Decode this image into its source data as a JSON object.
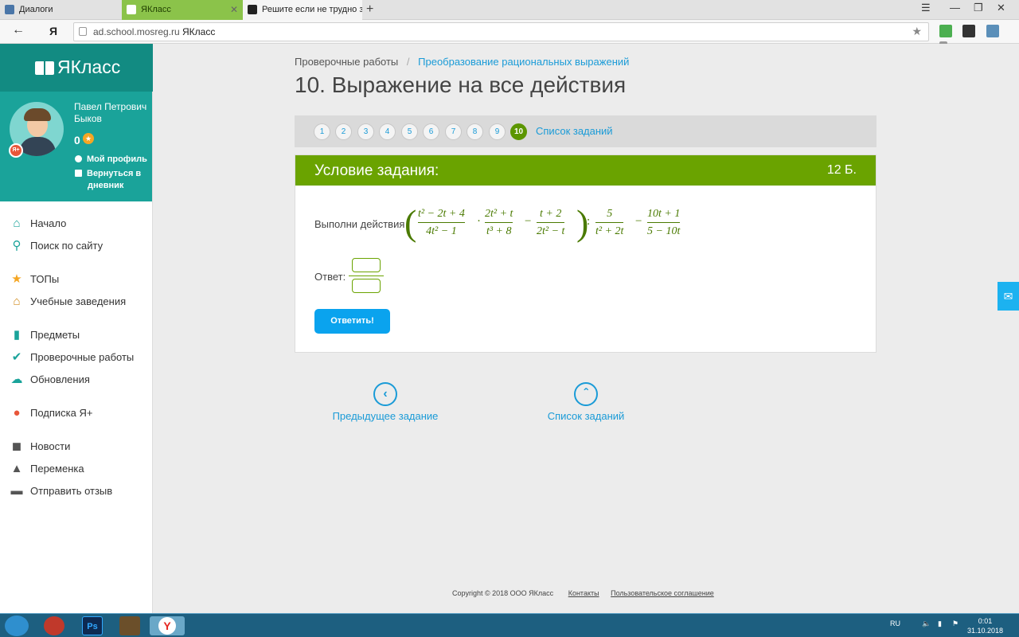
{
  "browser": {
    "tabs": [
      {
        "label": "Диалоги"
      },
      {
        "label": "ЯКласс"
      },
      {
        "label": "Решите если не трудно за"
      }
    ],
    "address": {
      "host": "ad.school.mosreg.ru",
      "title": "ЯКласс",
      "ya": "Я"
    }
  },
  "sidebar": {
    "logo": "ЯКласс",
    "user": {
      "name": "Павел Петрович Быков",
      "score": "0"
    },
    "links": {
      "profile": "Мой профиль",
      "diary": "Вернуться в дневник"
    },
    "menu": [
      {
        "label": "Начало",
        "icon": "home-icon"
      },
      {
        "label": "Поиск по сайту",
        "icon": "search-icon"
      },
      {
        "label": "ТОПы",
        "icon": "star-icon"
      },
      {
        "label": "Учебные заведения",
        "icon": "institution-icon"
      },
      {
        "label": "Предметы",
        "icon": "subjects-icon"
      },
      {
        "label": "Проверочные работы",
        "icon": "check-icon"
      },
      {
        "label": "Обновления",
        "icon": "updates-icon"
      },
      {
        "label": "Подписка Я+",
        "icon": "subscription-icon"
      },
      {
        "label": "Новости",
        "icon": "news-icon"
      },
      {
        "label": "Переменка",
        "icon": "bell-icon"
      },
      {
        "label": "Отправить отзыв",
        "icon": "feedback-icon"
      }
    ]
  },
  "main": {
    "breadcrumb": {
      "parent": "Проверочные работы",
      "sep": "/",
      "current": "Преобразование рациональных выражений"
    },
    "title": "10. Выражение на все действия",
    "task_numbers": [
      "1",
      "2",
      "3",
      "4",
      "5",
      "6",
      "7",
      "8",
      "9",
      "10"
    ],
    "active_task": "10",
    "task_list_link": "Список заданий",
    "card": {
      "header": "Условие задания:",
      "points": "12 Б.",
      "instruction": "Выполни действия",
      "expression": {
        "f1": {
          "num": "t² − 2t + 4",
          "den": "4t² − 1"
        },
        "dot": "·",
        "f2": {
          "num": "2t² + t",
          "den": "t³ + 8"
        },
        "minus1": "−",
        "f3": {
          "num": "t + 2",
          "den": "2t² − t"
        },
        "colon": ":",
        "f4": {
          "num": "5",
          "den": "t² + 2t"
        },
        "minus2": "−",
        "f5": {
          "num": "10t + 1",
          "den": "5 − 10t"
        }
      },
      "answer_label": "Ответ:",
      "answer_numerator": "",
      "answer_denominator": "",
      "submit": "Ответить!"
    },
    "prev_task": "Предыдущее задание",
    "task_list": "Список заданий",
    "footer": {
      "copyright": "Copyright © 2018 ООО ЯКласс",
      "contacts": "Контакты",
      "agreement": "Пользовательское соглашение"
    }
  },
  "taskbar": {
    "lang": "RU",
    "time": "0:01",
    "date": "31.10.2018"
  },
  "colors": {
    "brand": "#1aa39a",
    "accent_green": "#6aa300",
    "link": "#1a9bd7",
    "button": "#0aa3ee"
  }
}
